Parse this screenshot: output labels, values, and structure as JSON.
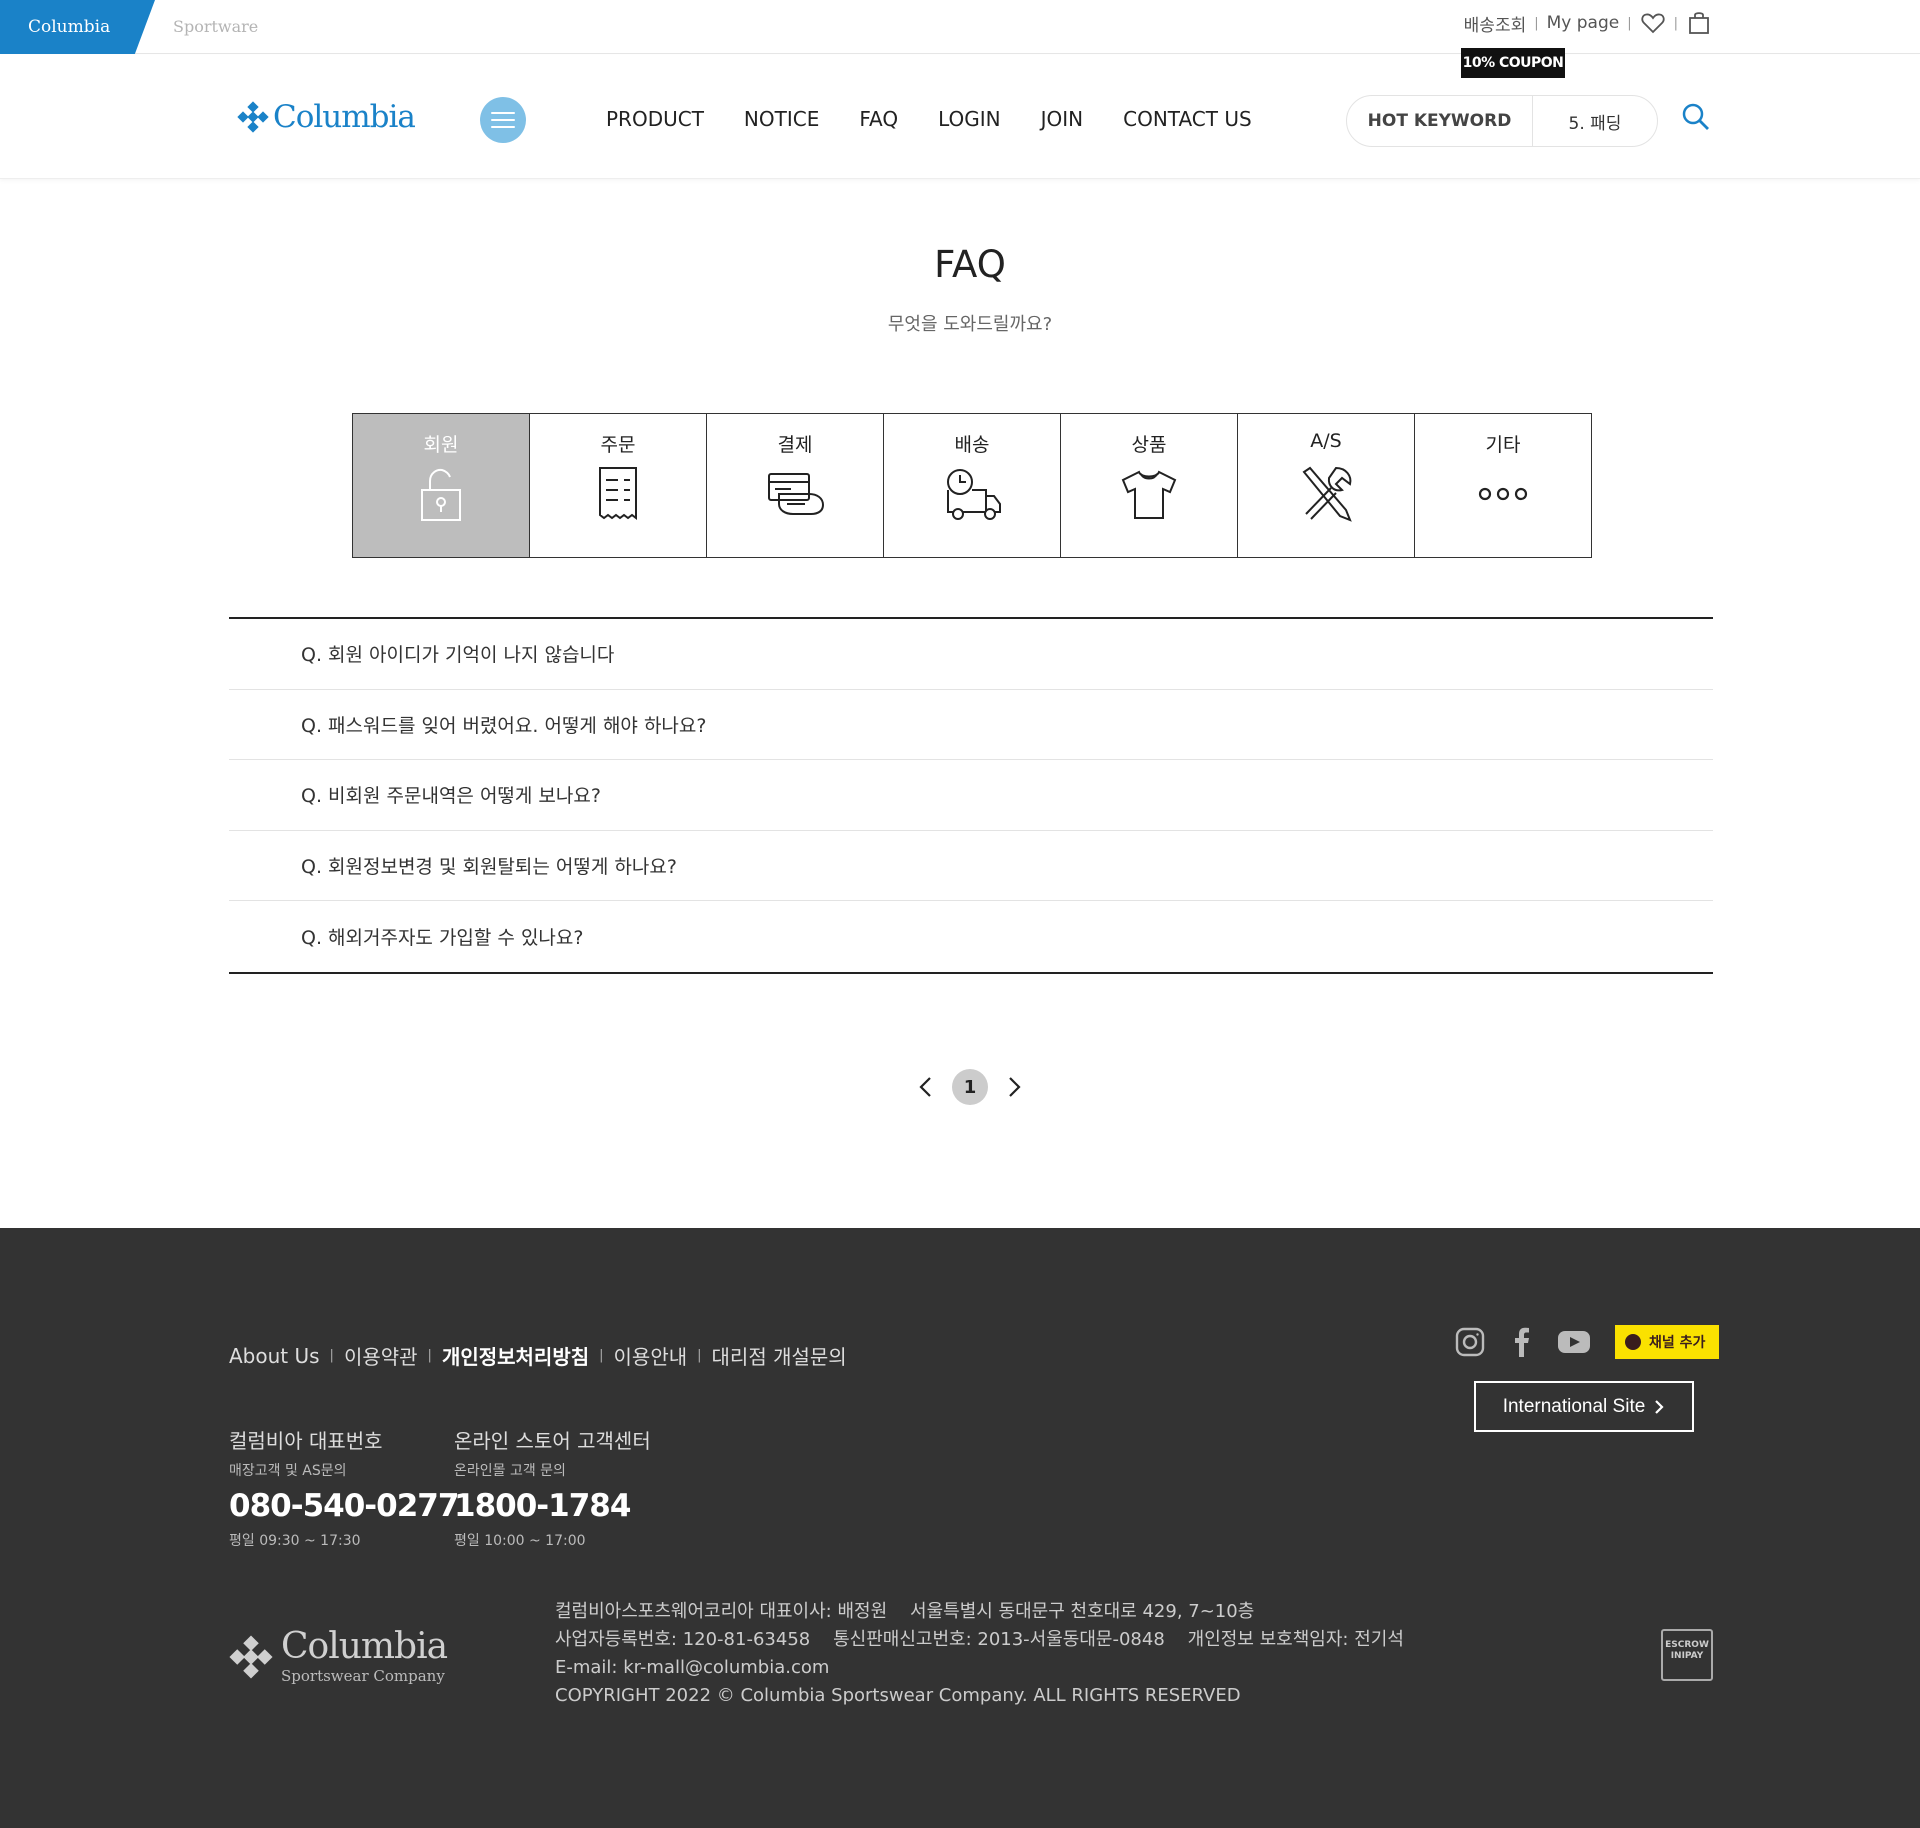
{
  "topbar": {
    "brand": "Columbia",
    "brand_sub": "Sportware",
    "delivery_lookup": "배송조회",
    "mypage": "My page",
    "coupon": "10% COUPON"
  },
  "header": {
    "logo_text": "Columbia",
    "nav": [
      "PRODUCT",
      "NOTICE",
      "FAQ",
      "LOGIN",
      "JOIN",
      "CONTACT US"
    ],
    "hot_keyword_label": "HOT KEYWORD",
    "hot_keyword_value": "5. 패딩"
  },
  "page": {
    "title": "FAQ",
    "subtitle": "무엇을 도와드릴까요?"
  },
  "categories": [
    {
      "label": "회원",
      "icon": "lock-icon",
      "active": true
    },
    {
      "label": "주문",
      "icon": "receipt-icon",
      "active": false
    },
    {
      "label": "결제",
      "icon": "payment-card-icon",
      "active": false
    },
    {
      "label": "배송",
      "icon": "delivery-truck-icon",
      "active": false
    },
    {
      "label": "상품",
      "icon": "tshirt-icon",
      "active": false
    },
    {
      "label": "A/S",
      "icon": "repair-tools-icon",
      "active": false
    },
    {
      "label": "기타",
      "icon": "more-dots-icon",
      "active": false
    }
  ],
  "faq": [
    "Q. 회원 아이디가 기억이 나지 않습니다",
    "Q. 패스워드를 잊어 버렸어요. 어떻게 해야 하나요?",
    "Q. 비회원 주문내역은 어떻게 보나요?",
    "Q. 회원정보변경 및 회원탈퇴는 어떻게 하나요?",
    "Q. 해외거주자도 가입할 수 있나요?"
  ],
  "pagination": {
    "current": "1"
  },
  "footer": {
    "links": [
      {
        "label": "About Us",
        "bold": false
      },
      {
        "label": "이용약관",
        "bold": false
      },
      {
        "label": "개인정보처리방침",
        "bold": true
      },
      {
        "label": "이용안내",
        "bold": false
      },
      {
        "label": "대리점 개설문의",
        "bold": false
      }
    ],
    "kakao": "채널 추가",
    "international": "International Site",
    "cs": [
      {
        "title": "컬럼비아 대표번호",
        "sub": "매장고객 및 AS문의",
        "number": "080-540-0277",
        "hours": "평일 09:30 ~ 17:30"
      },
      {
        "title": "온라인 스토어 고객센터",
        "sub": "온라인몰 고객 문의",
        "number": "1800-1784",
        "hours": "평일 10:00 ~ 17:00"
      }
    ],
    "logo_word": "Columbia",
    "logo_sub": "Sportswear Company",
    "info": [
      "컬럼비아스포츠웨어코리아 대표이사: 배정원    서울특별시 동대문구 천호대로 429, 7~10층",
      "사업자등록번호: 120-81-63458    통신판매신고번호: 2013-서울동대문-0848    개인정보 보호책임자: 전기석",
      "E-mail: kr-mall@columbia.com",
      "COPYRIGHT 2022 © Columbia Sportswear Company. ALL RIGHTS RESERVED"
    ],
    "escrow": [
      "ESCROW",
      "INIPAY"
    ]
  }
}
